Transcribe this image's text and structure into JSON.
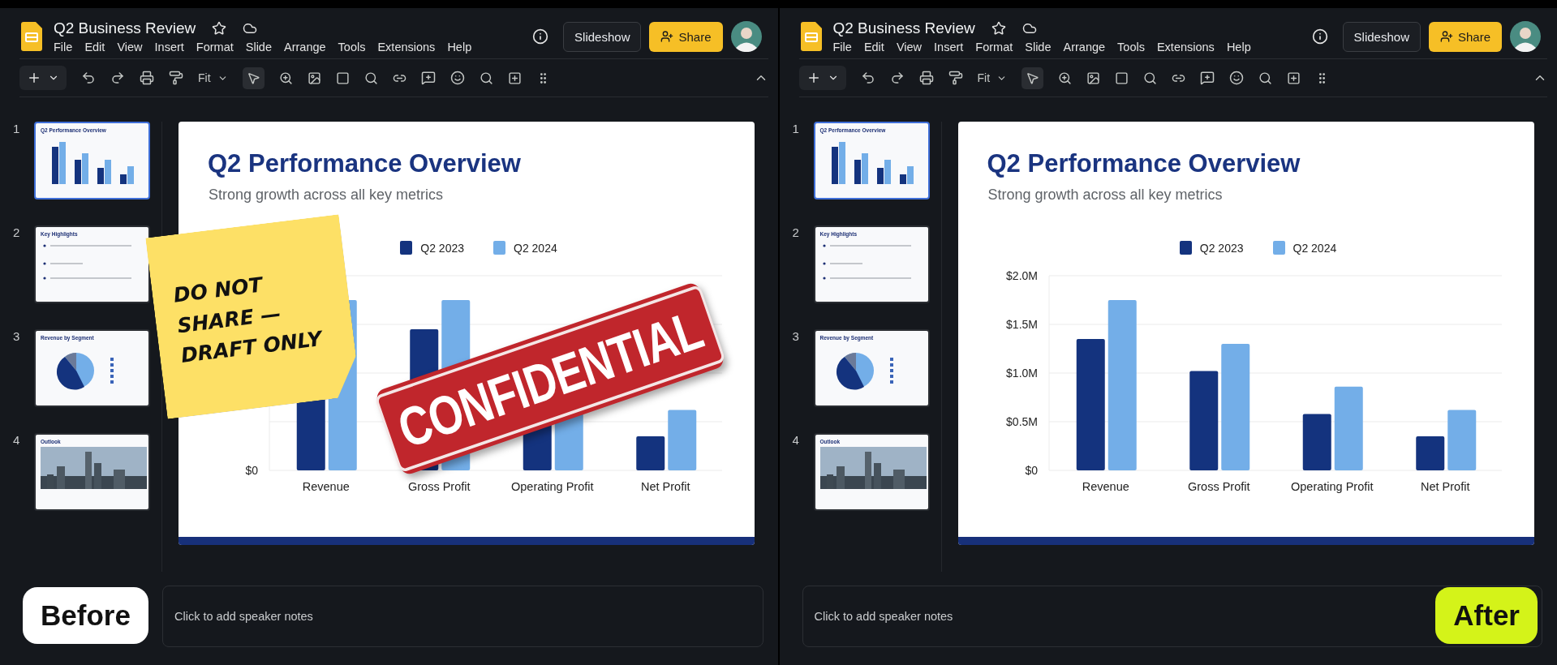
{
  "panels": [
    {
      "document_title": "Q2 Business Review",
      "menus": [
        "File",
        "Edit",
        "View",
        "Insert",
        "Format",
        "Slide",
        "Arrange",
        "Tools",
        "Extensions",
        "Help"
      ],
      "slideshow_button": "Slideshow",
      "share_button": "Share",
      "zoom": "Fit",
      "slides": [
        {
          "number": "1",
          "title": "Q2 Performance Overview",
          "kind": "bar_chart",
          "selected": true
        },
        {
          "number": "2",
          "title": "Key Highlights",
          "kind": "bullets",
          "selected": false
        },
        {
          "number": "3",
          "title": "Revenue by Segment",
          "kind": "pie",
          "selected": false
        },
        {
          "number": "4",
          "title": "Outlook",
          "kind": "picture",
          "selected": false
        }
      ],
      "slide": {
        "title": "Q2 Performance Overview",
        "subtitle": "Strong growth across all key metrics",
        "chart": {
          "kind": "picture",
          "legend": [
            "Q2 2023",
            "Q2 2024"
          ],
          "axis_label": "$0",
          "categories": [
            "Revenue",
            "Gross Profit",
            "Operating Profit",
            "Net Profit"
          ]
        }
      },
      "overlays": [
        {
          "kind": "sticky_note",
          "text": "DO NOT SHARE — DRAFT ONLY"
        },
        {
          "kind": "stamp",
          "text": "CONFIDENTIAL"
        }
      ],
      "notes_placeholder": "Click to add speaker notes",
      "badge": {
        "kind": "before",
        "label": "Before"
      }
    },
    {
      "document_title": "Q2 Business Review",
      "menus": [
        "File",
        "Edit",
        "View",
        "Insert",
        "Format",
        "Slide",
        "Arrange",
        "Tools",
        "Extensions",
        "Help"
      ],
      "slideshow_button": "Slideshow",
      "share_button": "Share",
      "zoom": "Fit",
      "slides": [
        {
          "number": "1",
          "title": "Q2 Performance Overview",
          "kind": "bar_chart",
          "selected": true
        },
        {
          "number": "2",
          "title": "Key Highlights",
          "kind": "bullets",
          "selected": false
        },
        {
          "number": "3",
          "title": "Revenue by Segment",
          "kind": "pie",
          "selected": false
        },
        {
          "number": "4",
          "title": "Outlook",
          "kind": "picture",
          "selected": false
        }
      ],
      "slide": {
        "title": "Q2 Performance Overview",
        "subtitle": "Strong growth across all key metrics",
        "chart_data": {
          "type": "bar",
          "categories": [
            "Revenue",
            "Gross Profit",
            "Operating Profit",
            "Net Profit"
          ],
          "series": [
            {
              "name": "Q2 2023",
              "color": "#14337e",
              "values": [
                1.35,
                1.02,
                0.58,
                0.35
              ]
            },
            {
              "name": "Q2 2024",
              "color": "#73aee8",
              "values": [
                1.75,
                1.3,
                0.86,
                0.62
              ]
            }
          ],
          "ylim": [
            0,
            2
          ],
          "yticks": [
            {
              "value": 0,
              "label": "$0"
            },
            {
              "value": 0.5,
              "label": "$0.5M"
            },
            {
              "value": 1,
              "label": "$1.0M"
            },
            {
              "value": 1.5,
              "label": "$1.5M"
            },
            {
              "value": 2,
              "label": "$2.0M"
            }
          ],
          "grid": true,
          "legend": true
        }
      },
      "notes_placeholder": "Click to add speaker notes",
      "badge": {
        "kind": "after",
        "label": "After"
      }
    }
  ]
}
